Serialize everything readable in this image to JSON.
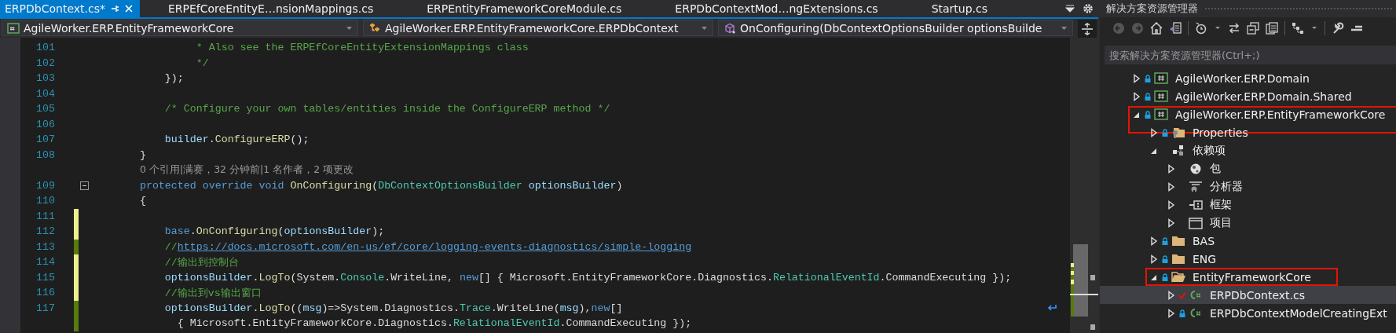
{
  "tabs": [
    {
      "label": "ERPDbContext.cs*",
      "selected": true,
      "pinned": true
    },
    {
      "label": "ERPEfCoreEntityE…nsionMappings.cs",
      "selected": false
    },
    {
      "label": "ERPEntityFrameworkCoreModule.cs",
      "selected": false
    },
    {
      "label": "ERPDbContextMod…ngExtensions.cs",
      "selected": false
    },
    {
      "label": "Startup.cs",
      "selected": false
    }
  ],
  "navigation": {
    "project": "AgileWorker.ERP.EntityFrameworkCore",
    "type": "AgileWorker.ERP.EntityFrameworkCore.ERPDbContext",
    "member": "OnConfiguring(DbContextOptionsBuilder optionsBuilde"
  },
  "editor": {
    "lines": [
      {
        "kind": "code",
        "number": "101",
        "tokens": [
          {
            "kind": "comment",
            "text": "             * Also see the ERPEfCoreEntityExtensionMappings class"
          }
        ]
      },
      {
        "kind": "code",
        "number": "102",
        "tokens": [
          {
            "kind": "comment",
            "text": "             */"
          }
        ]
      },
      {
        "kind": "code",
        "number": "103",
        "tokens": [
          {
            "kind": "plain",
            "text": "        });"
          }
        ]
      },
      {
        "kind": "code",
        "number": "104"
      },
      {
        "kind": "code",
        "number": "105",
        "tokens": [
          {
            "kind": "comment",
            "text": "        /* Configure your own tables/entities inside the ConfigureERP method */"
          }
        ]
      },
      {
        "kind": "code",
        "number": "106"
      },
      {
        "kind": "code",
        "number": "107",
        "tokens": [
          {
            "kind": "param",
            "text": "        builder"
          },
          {
            "kind": "plain",
            "text": "."
          },
          {
            "kind": "method",
            "text": "ConfigureERP"
          },
          {
            "kind": "plain",
            "text": "();"
          }
        ]
      },
      {
        "kind": "code",
        "number": "108",
        "tokens": [
          {
            "kind": "plain",
            "text": "    }"
          }
        ]
      },
      {
        "kind": "codelens",
        "text": "0 个引用|满赛，32 分钟前|1 名作者，2 项更改"
      },
      {
        "kind": "code",
        "number": "109",
        "fold": true,
        "tokens": [
          {
            "kind": "keyword",
            "text": "    protected override void "
          },
          {
            "kind": "method",
            "text": "OnConfiguring"
          },
          {
            "kind": "plain",
            "text": "("
          },
          {
            "kind": "type",
            "text": "DbContextOptionsBuilder "
          },
          {
            "kind": "param",
            "text": "optionsBuilder"
          },
          {
            "kind": "plain",
            "text": ")"
          }
        ]
      },
      {
        "kind": "code",
        "number": "110",
        "tokens": [
          {
            "kind": "plain",
            "text": "    {"
          }
        ]
      },
      {
        "kind": "code",
        "number": "111",
        "color": "#efef8f"
      },
      {
        "kind": "code",
        "number": "112",
        "color": "#efef8f",
        "tokens": [
          {
            "kind": "keyword",
            "text": "        base"
          },
          {
            "kind": "plain",
            "text": "."
          },
          {
            "kind": "method",
            "text": "OnConfiguring"
          },
          {
            "kind": "plain",
            "text": "("
          },
          {
            "kind": "param",
            "text": "optionsBuilder"
          },
          {
            "kind": "plain",
            "text": ");"
          }
        ]
      },
      {
        "kind": "code",
        "number": "113",
        "color": "#587c0c",
        "tokens": [
          {
            "kind": "comment",
            "text": "        //"
          },
          {
            "kind": "link",
            "text": "https://docs.microsoft.com/en-us/ef/core/logging-events-diagnostics/simple-logging"
          }
        ]
      },
      {
        "kind": "code",
        "number": "114",
        "color": "#efef8f",
        "tokens": [
          {
            "kind": "comment",
            "text": "        //输出到控制台"
          }
        ]
      },
      {
        "kind": "code",
        "number": "115",
        "color": "#efef8f",
        "tokens": [
          {
            "kind": "param",
            "text": "        optionsBuilder"
          },
          {
            "kind": "plain",
            "text": "."
          },
          {
            "kind": "method",
            "text": "LogTo"
          },
          {
            "kind": "plain",
            "text": "(System."
          },
          {
            "kind": "type",
            "text": "Console"
          },
          {
            "kind": "plain",
            "text": ".WriteLine, "
          },
          {
            "kind": "keyword",
            "text": "new"
          },
          {
            "kind": "plain",
            "text": "[] { Microsoft.EntityFrameworkCore.Diagnostics."
          },
          {
            "kind": "type",
            "text": "RelationalEventId"
          },
          {
            "kind": "plain",
            "text": ".CommandExecuting });"
          }
        ]
      },
      {
        "kind": "code",
        "number": "116",
        "color": "#efef8f",
        "tokens": [
          {
            "kind": "comment",
            "text": "        //输出到vs输出窗口"
          }
        ]
      },
      {
        "kind": "code",
        "number": "117",
        "color": "#587c0c",
        "wrapped": true,
        "tokens": [
          {
            "kind": "param",
            "text": "        optionsBuilder"
          },
          {
            "kind": "plain",
            "text": "."
          },
          {
            "kind": "method",
            "text": "LogTo"
          },
          {
            "kind": "plain",
            "text": "(("
          },
          {
            "kind": "param",
            "text": "msg"
          },
          {
            "kind": "plain",
            "text": ")=>System.Diagnostics."
          },
          {
            "kind": "type",
            "text": "Trace"
          },
          {
            "kind": "plain",
            "text": ".WriteLine("
          },
          {
            "kind": "param",
            "text": "msg"
          },
          {
            "kind": "plain",
            "text": "),"
          },
          {
            "kind": "keyword",
            "text": "new"
          },
          {
            "kind": "plain",
            "text": "[]"
          }
        ]
      },
      {
        "kind": "continuation",
        "color": "#587c0c",
        "tokens": [
          {
            "kind": "plain",
            "text": "          { Microsoft.EntityFrameworkCore.Diagnostics."
          },
          {
            "kind": "type",
            "text": "RelationalEventId"
          },
          {
            "kind": "plain",
            "text": ".CommandExecuting });"
          }
        ]
      }
    ]
  },
  "explorer": {
    "title": "解决方案资源管理器",
    "search": {
      "placeholder": "搜索解决方案资源管理器(Ctrl+;)"
    },
    "tree": [
      {
        "label": "AgileWorker.ERP.Domain",
        "kind": "cs-project",
        "locked": true,
        "expanded": false,
        "selected": false
      },
      {
        "label": "AgileWorker.ERP.Domain.Shared",
        "kind": "cs-project",
        "locked": true,
        "expanded": false,
        "selected": false
      },
      {
        "label": "AgileWorker.ERP.EntityFrameworkCore",
        "kind": "cs-project",
        "locked": true,
        "expanded": true,
        "selected": false,
        "outlined": true,
        "children": [
          {
            "label": "Properties",
            "kind": "properties",
            "locked": true,
            "expanded": false,
            "selected": false
          },
          {
            "label": "依赖项",
            "kind": "dependencies",
            "expanded": true,
            "selected": false,
            "children": [
              {
                "label": "包",
                "kind": "package",
                "expanded": false,
                "selected": false
              },
              {
                "label": "分析器",
                "kind": "analyzer",
                "expanded": false,
                "selected": false
              },
              {
                "label": "框架",
                "kind": "framework",
                "expanded": false,
                "selected": false
              },
              {
                "label": "项目",
                "kind": "project-ref",
                "expanded": false,
                "selected": false
              }
            ]
          },
          {
            "label": "BAS",
            "kind": "folder",
            "locked": true,
            "expanded": false,
            "selected": false
          },
          {
            "label": "ENG",
            "kind": "folder",
            "locked": true,
            "expanded": false,
            "selected": false
          },
          {
            "label": "EntityFrameworkCore",
            "kind": "folder-open",
            "locked": true,
            "expanded": true,
            "selected": false,
            "outlined": true,
            "children": [
              {
                "label": "ERPDbContext.cs",
                "kind": "cs-file",
                "checked_out": true,
                "expanded": false,
                "selected": true
              },
              {
                "label": "ERPDbContextModelCreatingExt",
                "kind": "cs-file",
                "locked": true,
                "expanded": false,
                "selected": false
              }
            ]
          }
        ]
      }
    ]
  }
}
